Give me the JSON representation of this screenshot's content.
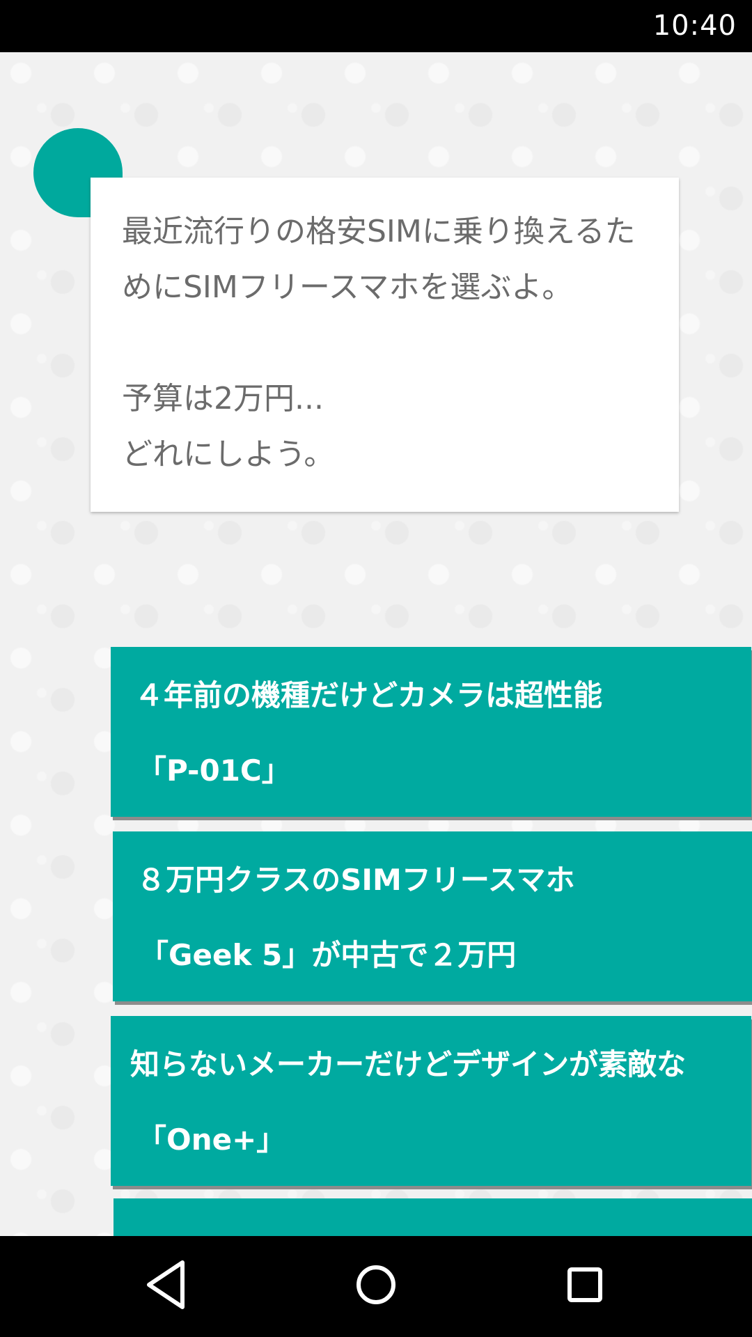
{
  "status_bar": {
    "time": "10:40"
  },
  "message": {
    "text": "最近流行りの格安SIMに乗り換えるた\nめにSIMフリースマホを選ぶよ。\n\n予算は2万円...\nどれにしよう。"
  },
  "choices": [
    {
      "line1": "４年前の機種だけどカメラは超性能",
      "line2": "「P-01C」"
    },
    {
      "line1": "８万円クラスのSIMフリースマホ",
      "line2": "「Geek 5」が中古で２万円"
    },
    {
      "line1": "知らないメーカーだけどデザインが素敵な",
      "line2": "「One+」"
    },
    {
      "line1": "",
      "line2": ""
    }
  ],
  "colors": {
    "accent": "#00aaa0",
    "avatar": "#00a99d",
    "card_text": "#6b6b6b"
  },
  "nav_bar": {
    "back_icon": "back-triangle-icon",
    "home_icon": "home-circle-icon",
    "recent_icon": "recent-square-icon"
  }
}
